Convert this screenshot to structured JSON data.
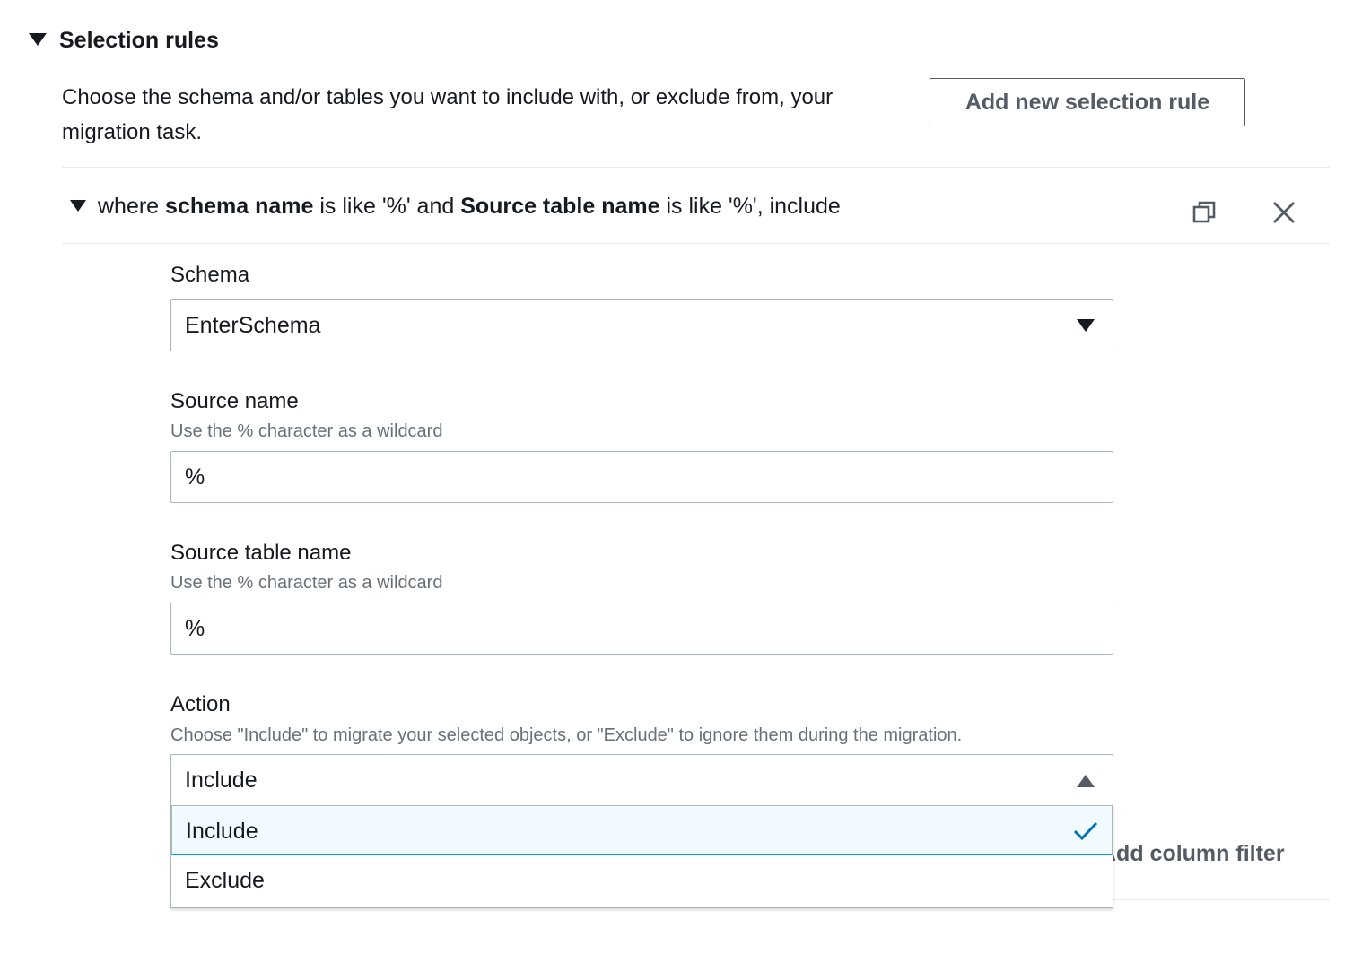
{
  "section": {
    "title": "Selection rules"
  },
  "description": "Choose the schema and/or tables you want to include with, or exclude from, your migration task.",
  "add_rule_button": "Add new selection rule",
  "rule": {
    "summary_where": "where ",
    "summary_schema_bold": "schema name",
    "summary_mid1": " is like '%' and ",
    "summary_table_bold": "Source table name",
    "summary_mid2": " is like '%', include"
  },
  "schema": {
    "label": "Schema",
    "value": "EnterSchema"
  },
  "source_name": {
    "label": "Source name",
    "hint": "Use the % character as a wildcard",
    "value": "%"
  },
  "source_table_name": {
    "label": "Source table name",
    "hint": "Use the % character as a wildcard",
    "value": "%"
  },
  "action": {
    "label": "Action",
    "hint": "Choose \"Include\" to migrate your selected objects, or \"Exclude\" to ignore them during the migration.",
    "value": "Include",
    "options": [
      "Include",
      "Exclude"
    ],
    "selected_option": "Include"
  },
  "add_column_filter": "Add column filter",
  "icons": {
    "section_caret": "caret-down-icon",
    "rule_caret": "caret-down-icon",
    "copy": "copy-icon",
    "close": "close-icon",
    "select_open": "caret-up-icon",
    "select_closed": "caret-down-icon",
    "selected_check": "check-icon"
  },
  "colors": {
    "accent": "#0073bb",
    "selected_bg": "#f1faff",
    "border": "#aab7b8",
    "hint": "#687078"
  }
}
